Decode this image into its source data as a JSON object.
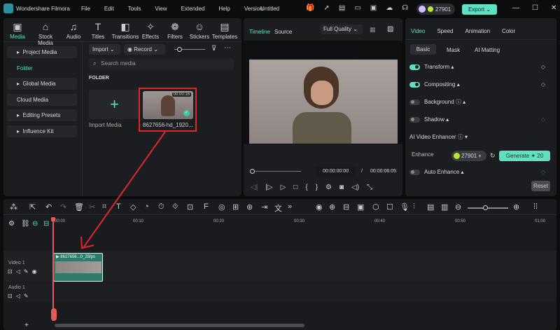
{
  "app": {
    "title": "Wondershare Filmora",
    "project": "Untitled",
    "menu": [
      "File",
      "Edit",
      "Tools",
      "View",
      "Extended",
      "Help",
      "Version"
    ],
    "credits": "27901",
    "export": "Export"
  },
  "tools": [
    {
      "label": "Media",
      "icon": "media-icon"
    },
    {
      "label": "Stock Media",
      "icon": "stock-media-icon"
    },
    {
      "label": "Audio",
      "icon": "audio-icon"
    },
    {
      "label": "Titles",
      "icon": "titles-icon"
    },
    {
      "label": "Transitions",
      "icon": "transitions-icon"
    },
    {
      "label": "Effects",
      "icon": "effects-icon"
    },
    {
      "label": "Filters",
      "icon": "filters-icon"
    },
    {
      "label": "Stickers",
      "icon": "stickers-icon"
    },
    {
      "label": "Templates",
      "icon": "templates-icon"
    }
  ],
  "sidebar": [
    "Project Media",
    "Folder",
    "Global Media",
    "Cloud Media",
    "Editing Presets",
    "Influence Kit"
  ],
  "media": {
    "import": "Import",
    "record": "Record",
    "search_placeholder": "Search media",
    "folder": "FOLDER",
    "import_media": "Import Media",
    "clip_name": "8627656-hd_1920...",
    "clip_duration": "00:00:16"
  },
  "preview": {
    "tab_timeline": "Timeline",
    "tab_source": "Source",
    "quality": "Full Quality",
    "current": "00:00:00:00",
    "sep": "/",
    "total": "00:00:06:05"
  },
  "props": {
    "tabs": [
      "Video",
      "Speed",
      "Animation",
      "Color"
    ],
    "subtabs": [
      "Basic",
      "Mask",
      "AI Matting"
    ],
    "transform": "Transform",
    "compositing": "Compositing",
    "background": "Background",
    "shadow": "Shadow",
    "enhancer": "AI Video Enhancer",
    "enhance": "Enhance",
    "credits": "27901",
    "generate": "Generate",
    "generate_cost": "20",
    "auto_enhance": "Auto Enhance",
    "reset": "Reset"
  },
  "timeline": {
    "ruler": [
      "00:00",
      "00:10",
      "00:20",
      "00:30",
      "00:40",
      "00:50",
      "01:00"
    ],
    "video_track": "Video 1",
    "audio_track": "Audio 1",
    "clip_label": "8627656...0_25fps"
  }
}
